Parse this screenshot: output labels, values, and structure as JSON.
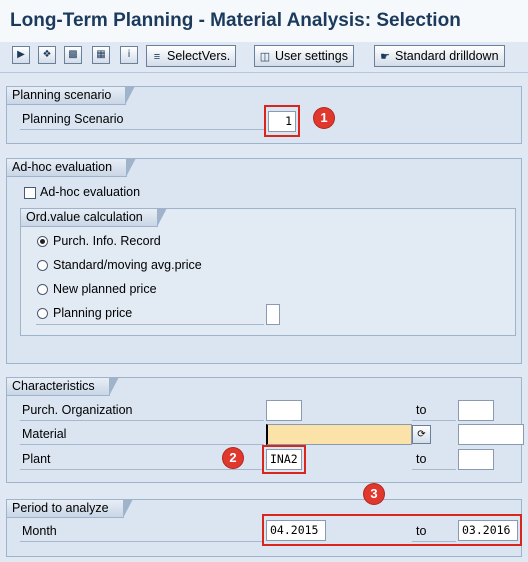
{
  "window": {
    "title": "Long-Term Planning - Material Analysis: Selection"
  },
  "toolbar": {
    "icons": [
      "execute-icon",
      "execute-print-icon",
      "save-variant-icon",
      "get-variant-icon",
      "info-icon"
    ],
    "buttons": [
      {
        "icon": "select-versions-icon",
        "label": "SelectVers."
      },
      {
        "icon": "user-settings-icon",
        "label": "User settings"
      },
      {
        "icon": "drilldown-icon",
        "label": "Standard drilldown"
      }
    ]
  },
  "planning_scenario": {
    "group_title": "Planning scenario",
    "label": "Planning Scenario",
    "value": "1",
    "badge": "1"
  },
  "adhoc": {
    "group_title": "Ad-hoc evaluation",
    "checkbox_label": "Ad-hoc evaluation",
    "checked": false,
    "ordvalue": {
      "group_title": "Ord.value calculation",
      "options": [
        {
          "label": "Purch. Info. Record",
          "selected": true
        },
        {
          "label": "Standard/moving avg.price",
          "selected": false
        },
        {
          "label": "New planned price",
          "selected": false
        },
        {
          "label": "Planning price",
          "selected": false
        }
      ],
      "planning_price_value": ""
    }
  },
  "characteristics": {
    "group_title": "Characteristics",
    "to_label": "to",
    "rows": [
      {
        "label": "Purch. Organization",
        "from": "",
        "to": ""
      },
      {
        "label": "Material",
        "from": "",
        "to": ""
      },
      {
        "label": "Plant",
        "from": "INA2",
        "to": ""
      }
    ],
    "badge": "2"
  },
  "period": {
    "group_title": "Period to analyze",
    "label": "Month",
    "from": "04.2015",
    "to_label": "to",
    "to": "03.2016",
    "badge": "3"
  }
}
